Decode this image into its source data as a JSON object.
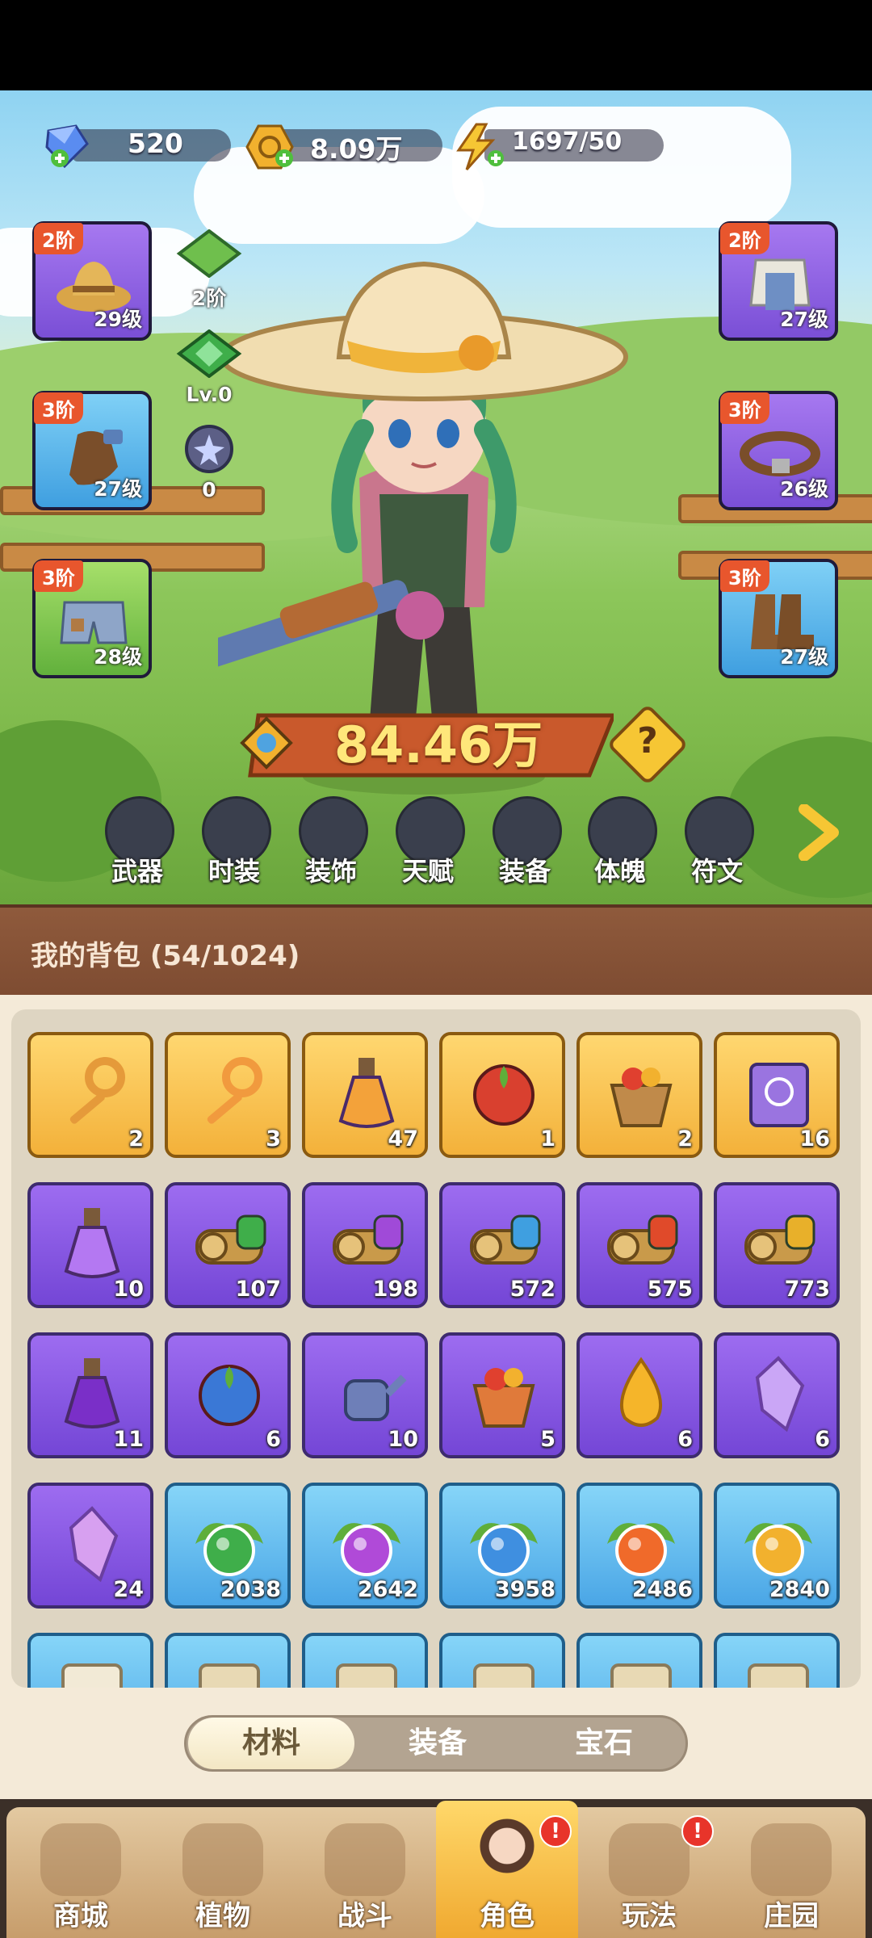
{
  "currency": [
    {
      "name": "diamond",
      "value": "520",
      "icon": "diamond-icon",
      "color": "#5a8cf0"
    },
    {
      "name": "gold",
      "value": "8.09万",
      "icon": "gold-coin-icon",
      "color": "#f2b12e"
    },
    {
      "name": "energy",
      "value": "1697/50",
      "icon": "lightning-icon",
      "color": "#f6c634"
    }
  ],
  "slots_left": [
    {
      "tier": "2阶",
      "level": "29级",
      "icon": "straw-hat-icon",
      "color": "purple"
    },
    {
      "tier": "3阶",
      "level": "27级",
      "icon": "glove-icon",
      "color": "blue"
    },
    {
      "tier": "3阶",
      "level": "28级",
      "icon": "shorts-icon",
      "color": "green"
    }
  ],
  "slots_right": [
    {
      "tier": "2阶",
      "level": "27级",
      "icon": "overalls-icon",
      "color": "purple"
    },
    {
      "tier": "3阶",
      "level": "26级",
      "icon": "belt-icon",
      "color": "purple"
    },
    {
      "tier": "3阶",
      "level": "27级",
      "icon": "boots-icon",
      "color": "blue"
    }
  ],
  "gems": [
    {
      "label": "2阶",
      "icon": "green-gem-bag-icon"
    },
    {
      "label": "Lv.0",
      "icon": "green-crystal-icon"
    },
    {
      "label": "0",
      "icon": "star-orb-icon"
    }
  ],
  "power": {
    "value": "84.46万",
    "help": "?"
  },
  "categories": [
    {
      "label": "武器",
      "icon": "weapon-icon"
    },
    {
      "label": "时装",
      "icon": "outfit-icon"
    },
    {
      "label": "装饰",
      "icon": "mask-icon"
    },
    {
      "label": "天赋",
      "icon": "talent-icon"
    },
    {
      "label": "装备",
      "icon": "equipment-icon"
    },
    {
      "label": "体魄",
      "icon": "physique-icon"
    },
    {
      "label": "符文",
      "icon": "rune-icon"
    }
  ],
  "bag": {
    "title": "我的背包 (54/1024)"
  },
  "items": [
    {
      "count": "2",
      "icon": "double-key-icon",
      "color": "gold"
    },
    {
      "count": "3",
      "icon": "gem-key-icon",
      "color": "gold"
    },
    {
      "count": "47",
      "icon": "potion-bottle-icon",
      "color": "gold"
    },
    {
      "count": "1",
      "icon": "red-flower-bud-icon",
      "color": "gold"
    },
    {
      "count": "2",
      "icon": "flower-pot-icon",
      "color": "gold"
    },
    {
      "count": "16",
      "icon": "spell-book-icon",
      "color": "gold"
    },
    {
      "count": "10",
      "icon": "purple-potion-icon",
      "color": "purple"
    },
    {
      "count": "107",
      "icon": "scroll-green-icon",
      "color": "purple"
    },
    {
      "count": "198",
      "icon": "scroll-purple-icon",
      "color": "purple"
    },
    {
      "count": "572",
      "icon": "scroll-blue-icon",
      "color": "purple"
    },
    {
      "count": "575",
      "icon": "scroll-red-icon",
      "color": "purple"
    },
    {
      "count": "773",
      "icon": "scroll-yellow-icon",
      "color": "purple"
    },
    {
      "count": "11",
      "icon": "purple-flask-icon",
      "color": "purple"
    },
    {
      "count": "6",
      "icon": "blue-bud-icon",
      "color": "purple"
    },
    {
      "count": "10",
      "icon": "watering-can-icon",
      "color": "purple"
    },
    {
      "count": "5",
      "icon": "fruit-bowl-icon",
      "color": "purple"
    },
    {
      "count": "6",
      "icon": "golden-drop-icon",
      "color": "purple"
    },
    {
      "count": "6",
      "icon": "purple-crystal-icon",
      "color": "purple"
    },
    {
      "count": "24",
      "icon": "pink-crystal-icon",
      "color": "purple"
    },
    {
      "count": "2038",
      "icon": "green-seed-orb-icon",
      "color": "blue"
    },
    {
      "count": "2642",
      "icon": "purple-seed-orb-icon",
      "color": "blue"
    },
    {
      "count": "3958",
      "icon": "blue-seed-orb-icon",
      "color": "blue"
    },
    {
      "count": "2486",
      "icon": "fire-seed-orb-icon",
      "color": "blue"
    },
    {
      "count": "2840",
      "icon": "lightning-seed-orb-icon",
      "color": "blue"
    }
  ],
  "partial_row_icons": [
    "white-bulb-icon",
    "blueprint-icon",
    "blueprint-icon",
    "blueprint-icon",
    "blueprint-icon",
    "blueprint-icon"
  ],
  "tabs": [
    {
      "label": "材料",
      "active": true
    },
    {
      "label": "装备",
      "active": false
    },
    {
      "label": "宝石",
      "active": false
    }
  ],
  "nav": [
    {
      "label": "商城",
      "icon": "shop-icon",
      "active": false,
      "badge": ""
    },
    {
      "label": "植物",
      "icon": "plant-icon",
      "active": false,
      "badge": ""
    },
    {
      "label": "战斗",
      "icon": "battle-icon",
      "active": false,
      "badge": ""
    },
    {
      "label": "角色",
      "icon": "character-icon",
      "active": true,
      "badge": "!"
    },
    {
      "label": "玩法",
      "icon": "gameplay-icon",
      "active": false,
      "badge": "!"
    },
    {
      "label": "庄园",
      "icon": "manor-icon",
      "active": false,
      "badge": ""
    }
  ]
}
